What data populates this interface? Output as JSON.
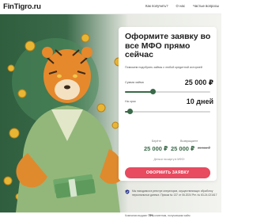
{
  "header": {
    "logo": "FinTigro.ru",
    "nav": [
      "Как получить?",
      "О нас",
      "Частые вопросы"
    ]
  },
  "form": {
    "title": "Оформите заявку во все МФО прямо сейчас",
    "subtitle": "Поможем подобрать займы с любой кредитной историей",
    "amount_label": "Сумма займа",
    "amount_value": "25 000 ₽",
    "amount_level": 0.33,
    "term_label": "На срок",
    "term_value": "10 дней",
    "term_level": 0.06,
    "summary": {
      "left_label": "Берёте",
      "left_value": "25 000 ₽",
      "right_label": "Возвращаете",
      "right_value": "25 000 ₽",
      "right_old": "25 000 ₽",
      "note": "Деньги на карту в МФО!"
    },
    "cta_label": "ОФОРМИТЬ ЗАЯВКУ"
  },
  "legal": {
    "text": "Мы находимся в реестре операторов, осуществляющих обработку персональных данных. Приказ № 137 от 06.2024 Рег. № 63-24-021617"
  },
  "footer": {
    "prefix": "Компании выдают ",
    "highlight": "79%",
    "suffix": " клиентам, получившим займ"
  },
  "colors": {
    "brand_green": "#3a6a49",
    "cta_red": "#e84a5f",
    "accent_red": "#e84a5f"
  }
}
